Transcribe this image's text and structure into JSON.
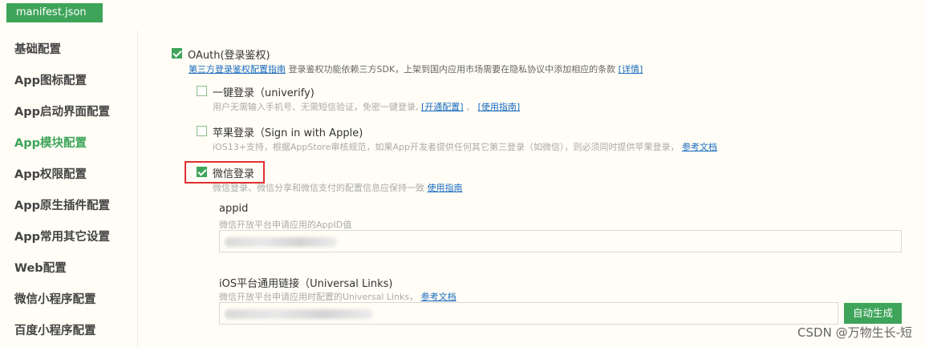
{
  "file_tab": "manifest.json",
  "sidebar": {
    "items": [
      {
        "label": "基础配置",
        "active": false
      },
      {
        "label": "App图标配置",
        "active": false
      },
      {
        "label": "App启动界面配置",
        "active": false
      },
      {
        "label": "App模块配置",
        "active": true
      },
      {
        "label": "App权限配置",
        "active": false
      },
      {
        "label": "App原生插件配置",
        "active": false
      },
      {
        "label": "App常用其它设置",
        "active": false
      },
      {
        "label": "Web配置",
        "active": false
      },
      {
        "label": "微信小程序配置",
        "active": false
      },
      {
        "label": "百度小程序配置",
        "active": false
      }
    ]
  },
  "oauth": {
    "label": "OAuth(登录鉴权)",
    "checked": true,
    "guide_link": "第三方登录鉴权配置指南",
    "desc": "登录鉴权功能依赖三方SDK，上架到国内应用市场需要在隐私协议中添加相应的条款",
    "detail_link": "[详情]"
  },
  "univerify": {
    "label": "一键登录（univerify)",
    "checked": false,
    "desc": "用户无需输入手机号、无需短信验证，免密一键登录, ",
    "open_link": "[开通配置]",
    "sep": "、",
    "guide_link": "[使用指南]"
  },
  "apple": {
    "label": "苹果登录（Sign in with Apple)",
    "checked": false,
    "desc": "iOS13+支持，根据AppStore审核规范，如果App开发者提供任何其它第三登录（如微信），则必须同时提供苹果登录，",
    "doc_link": "参考文档"
  },
  "wechat": {
    "label": "微信登录",
    "checked": true,
    "desc": "微信登录、微信分享和微信支付的配置信息应保持一致",
    "guide_link": "使用指南"
  },
  "appid": {
    "title": "appid",
    "desc": "微信开放平台申请应用的AppID值"
  },
  "universal_links": {
    "title": "iOS平台通用链接（Universal Links)",
    "desc": "微信开放平台申请应用时配置的Universal Links，",
    "doc_link": "参考文档",
    "button": "自动生成"
  },
  "watermark": "CSDN @万物生长-短"
}
